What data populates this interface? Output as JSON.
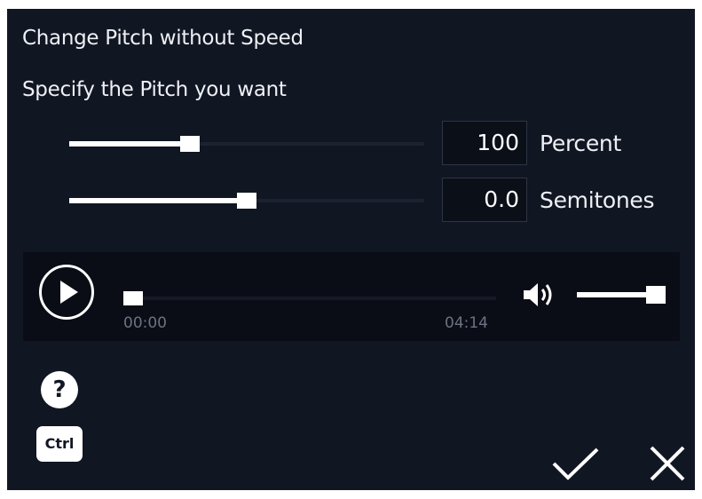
{
  "dialog": {
    "title": "Change Pitch without Speed",
    "subtitle": "Specify the Pitch you want"
  },
  "pitch": {
    "percent_value": "100",
    "percent_unit": "Percent",
    "percent_slider_level": 0.34,
    "semitones_value": "0.0",
    "semitones_unit": "Semitones",
    "semitones_slider_level": 0.5
  },
  "player": {
    "current_time": "00:00",
    "total_time": "04:14",
    "playback_position": 0,
    "volume_level": 1.0
  },
  "buttons": {
    "help_label": "?",
    "ctrl_label": "Ctrl"
  },
  "icons": {
    "play": "play-icon",
    "volume": "volume-icon",
    "confirm": "check-icon",
    "close": "close-icon"
  },
  "colors": {
    "background": "#111623",
    "player_background": "#0a0d16",
    "foreground": "#ffffff",
    "muted_text": "#6c7280"
  }
}
